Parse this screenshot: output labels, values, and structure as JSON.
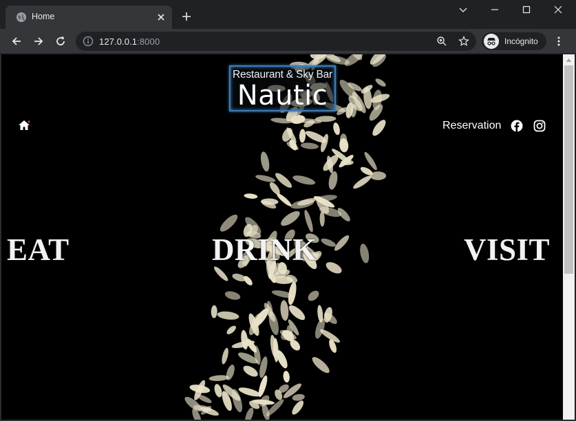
{
  "browser": {
    "tab_title": "Home",
    "url_host": "127.0.0.1",
    "url_port": ":8000",
    "profile_label": "Incógnito"
  },
  "site": {
    "logo_tagline": "Restaurant & Sky Bar",
    "logo_brand": "Nautic",
    "nav": {
      "reservation_label": "Reservation"
    },
    "hero": {
      "words": [
        "EAT",
        "DRINK",
        "VISIT"
      ]
    }
  },
  "colors": {
    "chrome_bg": "#202124",
    "toolbar_bg": "#35363a",
    "logo_border": "#3d7cb8",
    "hero_bg": "#000000",
    "rice": "#e9e2c8"
  },
  "icons": [
    "globe-icon",
    "close-icon",
    "plus-icon",
    "chevron-down-icon",
    "minimize-icon",
    "maximize-icon",
    "back-icon",
    "forward-icon",
    "reload-icon",
    "info-icon",
    "zoom-icon",
    "star-icon",
    "incognito-icon",
    "kebab-menu-icon",
    "home-icon",
    "facebook-icon",
    "instagram-icon"
  ]
}
